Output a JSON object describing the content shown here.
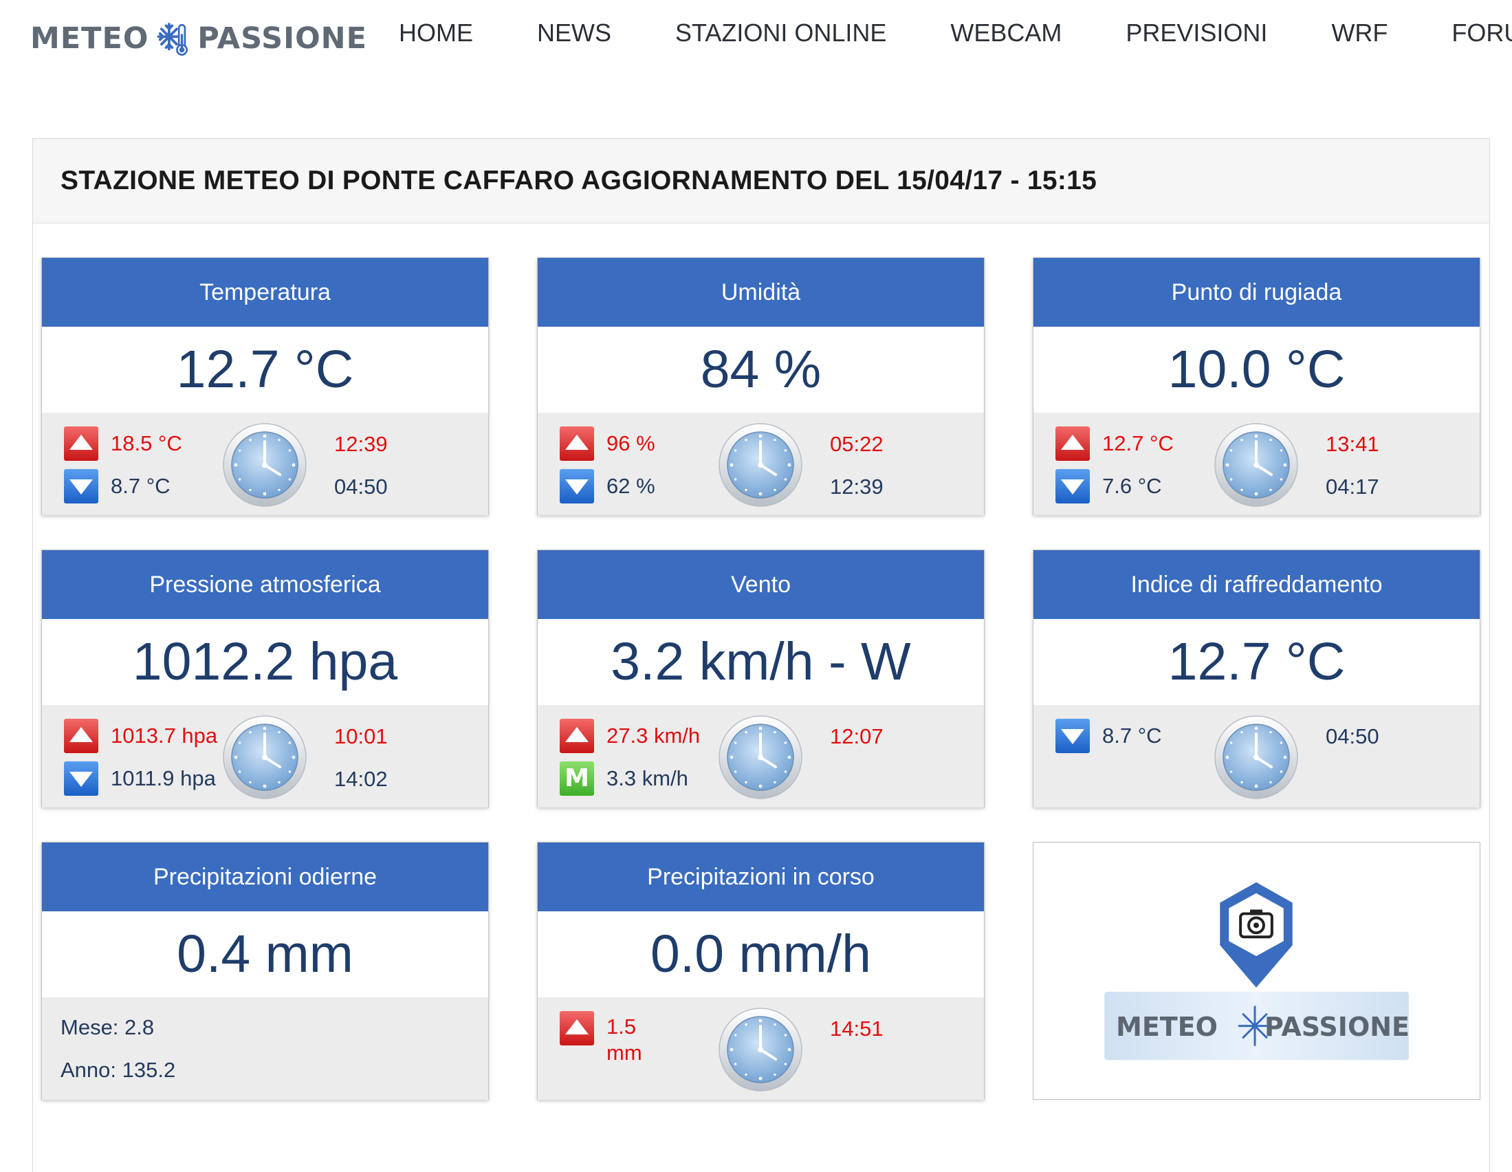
{
  "brand": {
    "left": "METEO",
    "right": "PASSIONE"
  },
  "nav": [
    "HOME",
    "NEWS",
    "STAZIONI ONLINE",
    "WEBCAM",
    "PREVISIONI",
    "WRF",
    "FORU"
  ],
  "colors": {
    "card_header": "#3a6cbf",
    "value_text": "#1f3d6b",
    "max_red": "#e10f0f",
    "footer_bg": "#ececec"
  },
  "station": {
    "title": "STAZIONE METEO DI PONTE CAFFARO AGGIORNAMENTO DEL 15/04/17 - 15:15",
    "cards": {
      "temperatura": {
        "title": "Temperatura",
        "value": "12.7 °C",
        "max": "18.5 °C",
        "max_time": "12:39",
        "min": "8.7 °C",
        "min_time": "04:50"
      },
      "umidita": {
        "title": "Umidità",
        "value": "84 %",
        "max": "96 %",
        "max_time": "05:22",
        "min": "62 %",
        "min_time": "12:39"
      },
      "rugiada": {
        "title": "Punto di rugiada",
        "value": "10.0 °C",
        "max": "12.7 °C",
        "max_time": "13:41",
        "min": "7.6 °C",
        "min_time": "04:17"
      },
      "pressione": {
        "title": "Pressione atmosferica",
        "value": "1012.2 hpa",
        "max": "1013.7 hpa",
        "max_time": "10:01",
        "min": "1011.9 hpa",
        "min_time": "14:02"
      },
      "vento": {
        "title": "Vento",
        "value": "3.2 km/h - W",
        "max": "27.3 km/h",
        "max_time": "12:07",
        "media_icon": "M",
        "media": "3.3 km/h"
      },
      "raffreddamento": {
        "title": "Indice di raffreddamento",
        "value": "12.7 °C",
        "min": "8.7 °C",
        "min_time": "04:50"
      },
      "precip_odierne": {
        "title": "Precipitazioni odierne",
        "value": "0.4 mm",
        "mese": "Mese: 2.8",
        "anno": "Anno: 135.2"
      },
      "precip_corso": {
        "title": "Precipitazioni in corso",
        "value": "0.0 mm/h",
        "max_num": "1.5",
        "max_unit": "mm",
        "max_time": "14:51"
      }
    },
    "logo_card": {
      "left": "METEO",
      "right": "PASSIONE"
    }
  }
}
